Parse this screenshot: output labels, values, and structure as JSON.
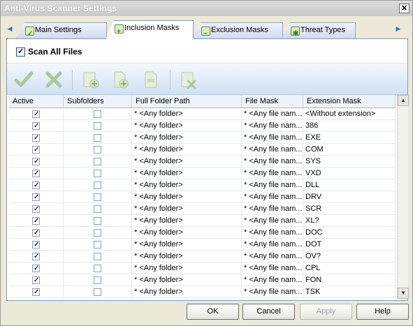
{
  "window": {
    "title": "Anti-Virus Scanner Settings"
  },
  "tabs": [
    {
      "label": "Main Settings",
      "icon": "settings-icon"
    },
    {
      "label": "Inclusion Masks",
      "icon": "add-icon",
      "active": true
    },
    {
      "label": "Exclusion Masks",
      "icon": "remove-icon"
    },
    {
      "label": "Threat Types",
      "icon": "bug-icon"
    }
  ],
  "scan_all_files": {
    "label": "Scan All Files",
    "checked": true
  },
  "toolbar": {
    "buttons": [
      "apply-check",
      "cancel-x",
      "add-folder",
      "add-file",
      "add-mask",
      "delete-entry"
    ]
  },
  "table": {
    "columns": [
      "Active",
      "Subfolders",
      "Full Folder Path",
      "File Mask",
      "Extension Mask"
    ],
    "rows": [
      {
        "active": true,
        "subfolders": false,
        "path": "* <Any folder>",
        "mask": "* <Any file nam...",
        "ext": "<Without extension>"
      },
      {
        "active": true,
        "subfolders": false,
        "path": "* <Any folder>",
        "mask": "* <Any file nam...",
        "ext": "386"
      },
      {
        "active": true,
        "subfolders": false,
        "path": "* <Any folder>",
        "mask": "* <Any file nam...",
        "ext": "EXE"
      },
      {
        "active": true,
        "subfolders": false,
        "path": "* <Any folder>",
        "mask": "* <Any file nam...",
        "ext": "COM"
      },
      {
        "active": true,
        "subfolders": false,
        "path": "* <Any folder>",
        "mask": "* <Any file nam...",
        "ext": "SYS"
      },
      {
        "active": true,
        "subfolders": false,
        "path": "* <Any folder>",
        "mask": "* <Any file nam...",
        "ext": "VXD"
      },
      {
        "active": true,
        "subfolders": false,
        "path": "* <Any folder>",
        "mask": "* <Any file nam...",
        "ext": "DLL"
      },
      {
        "active": true,
        "subfolders": false,
        "path": "* <Any folder>",
        "mask": "* <Any file nam...",
        "ext": "DRV"
      },
      {
        "active": true,
        "subfolders": false,
        "path": "* <Any folder>",
        "mask": "* <Any file nam...",
        "ext": "SCR"
      },
      {
        "active": true,
        "subfolders": false,
        "path": "* <Any folder>",
        "mask": "* <Any file nam...",
        "ext": "XL?"
      },
      {
        "active": true,
        "subfolders": false,
        "path": "* <Any folder>",
        "mask": "* <Any file nam...",
        "ext": "DOC"
      },
      {
        "active": true,
        "subfolders": false,
        "path": "* <Any folder>",
        "mask": "* <Any file nam...",
        "ext": "DOT"
      },
      {
        "active": true,
        "subfolders": false,
        "path": "* <Any folder>",
        "mask": "* <Any file nam...",
        "ext": "OV?"
      },
      {
        "active": true,
        "subfolders": false,
        "path": "* <Any folder>",
        "mask": "* <Any file nam...",
        "ext": "CPL"
      },
      {
        "active": true,
        "subfolders": false,
        "path": "* <Any folder>",
        "mask": "* <Any file nam...",
        "ext": "FON"
      },
      {
        "active": true,
        "subfolders": false,
        "path": "* <Any folder>",
        "mask": "* <Any file nam...",
        "ext": "TSK"
      }
    ]
  },
  "buttons": {
    "ok": "OK",
    "cancel": "Cancel",
    "apply": "Apply",
    "help": "Help"
  }
}
